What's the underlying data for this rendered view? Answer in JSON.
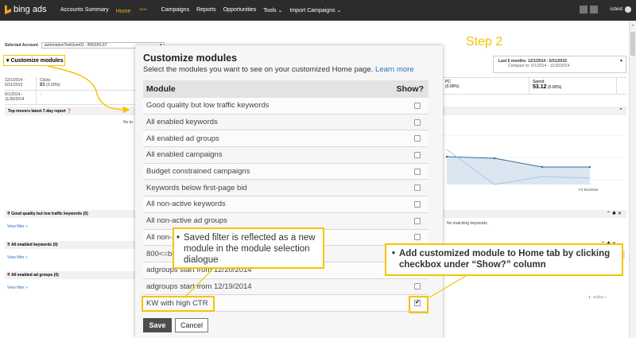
{
  "topbar": {
    "logo": "bing ads",
    "nav": [
      "Accounts Summary",
      "Home",
      "Campaigns",
      "Reports",
      "Opportunities",
      "Tools ⌄",
      "Import Campaigns ⌄"
    ],
    "home_badge": "NEW",
    "user": "cctest"
  },
  "page": {
    "selected_account_label": "Selected Account",
    "selected_account_value": "automationTestUser01 - B001HLST",
    "customize_modules": "Customize modules",
    "step_label": "Step 2",
    "date_range": "Last 6 months: 12/1/2014 - 5/31/2015",
    "compare_to": "Compare to: 6/1/2014 - 11/30/2014",
    "period1": "12/1/2014 - 5/31/2015",
    "period2": "6/1/2014 - 11/30/2014",
    "clicks_label": "Clicks",
    "clicks_value": "81",
    "clicks_change": "(0.00%)",
    "clicks_prev": "-",
    "top_movers": "Top movers latest 7-day report",
    "top_movers_note": "No to",
    "panel1_title": "Good quality but low traffic keywords (0)",
    "panel2_title": "All enabled keywords (0)",
    "panel3_title": "All enabled ad groups (0)",
    "view_filter": "View filter »",
    "pc_label": "PC",
    "pc_change": "(0.00%)",
    "spend_label": "Spend",
    "spend_value": "53.12",
    "spend_change": "(0.00%)",
    "chart_axis_label": "Fri 5/1/2015",
    "no_matching": "No matching keywords.",
    "pager": "1 - 3 of 3"
  },
  "modal": {
    "title": "Customize modules",
    "subtitle": "Select the modules you want to see on your customized Home page.",
    "learn_more": "Learn more",
    "col_module": "Module",
    "col_show": "Show?",
    "rows": [
      {
        "label": "Good quality but low traffic keywords",
        "checked": false
      },
      {
        "label": "All enabled keywords",
        "checked": false
      },
      {
        "label": "All enabled ad groups",
        "checked": false
      },
      {
        "label": "All enabled campaigns",
        "checked": false
      },
      {
        "label": "Budget constrained campaigns",
        "checked": false
      },
      {
        "label": "Keywords below first-page bid",
        "checked": false
      },
      {
        "label": "All non-active keywords",
        "checked": false
      },
      {
        "label": "All non-active ad groups",
        "checked": false
      },
      {
        "label": "All non-ac",
        "checked": false
      },
      {
        "label": "800<=bud",
        "checked": false
      },
      {
        "label": "adgroups start from 12/20/2014",
        "checked": false
      },
      {
        "label": "adgroups start from 12/19/2014",
        "checked": false
      },
      {
        "label": "KW with high CTR",
        "checked": true
      }
    ],
    "save": "Save",
    "cancel": "Cancel"
  },
  "callouts": {
    "one": "Saved filter is reflected as a new module in the module selection dialogue",
    "two": "Add customized module to Home tab by clicking checkbox under “Show?” column"
  },
  "colors": {
    "accent": "#f5c400",
    "topbar": "#2c2c2c",
    "link": "#2b6fb5"
  }
}
